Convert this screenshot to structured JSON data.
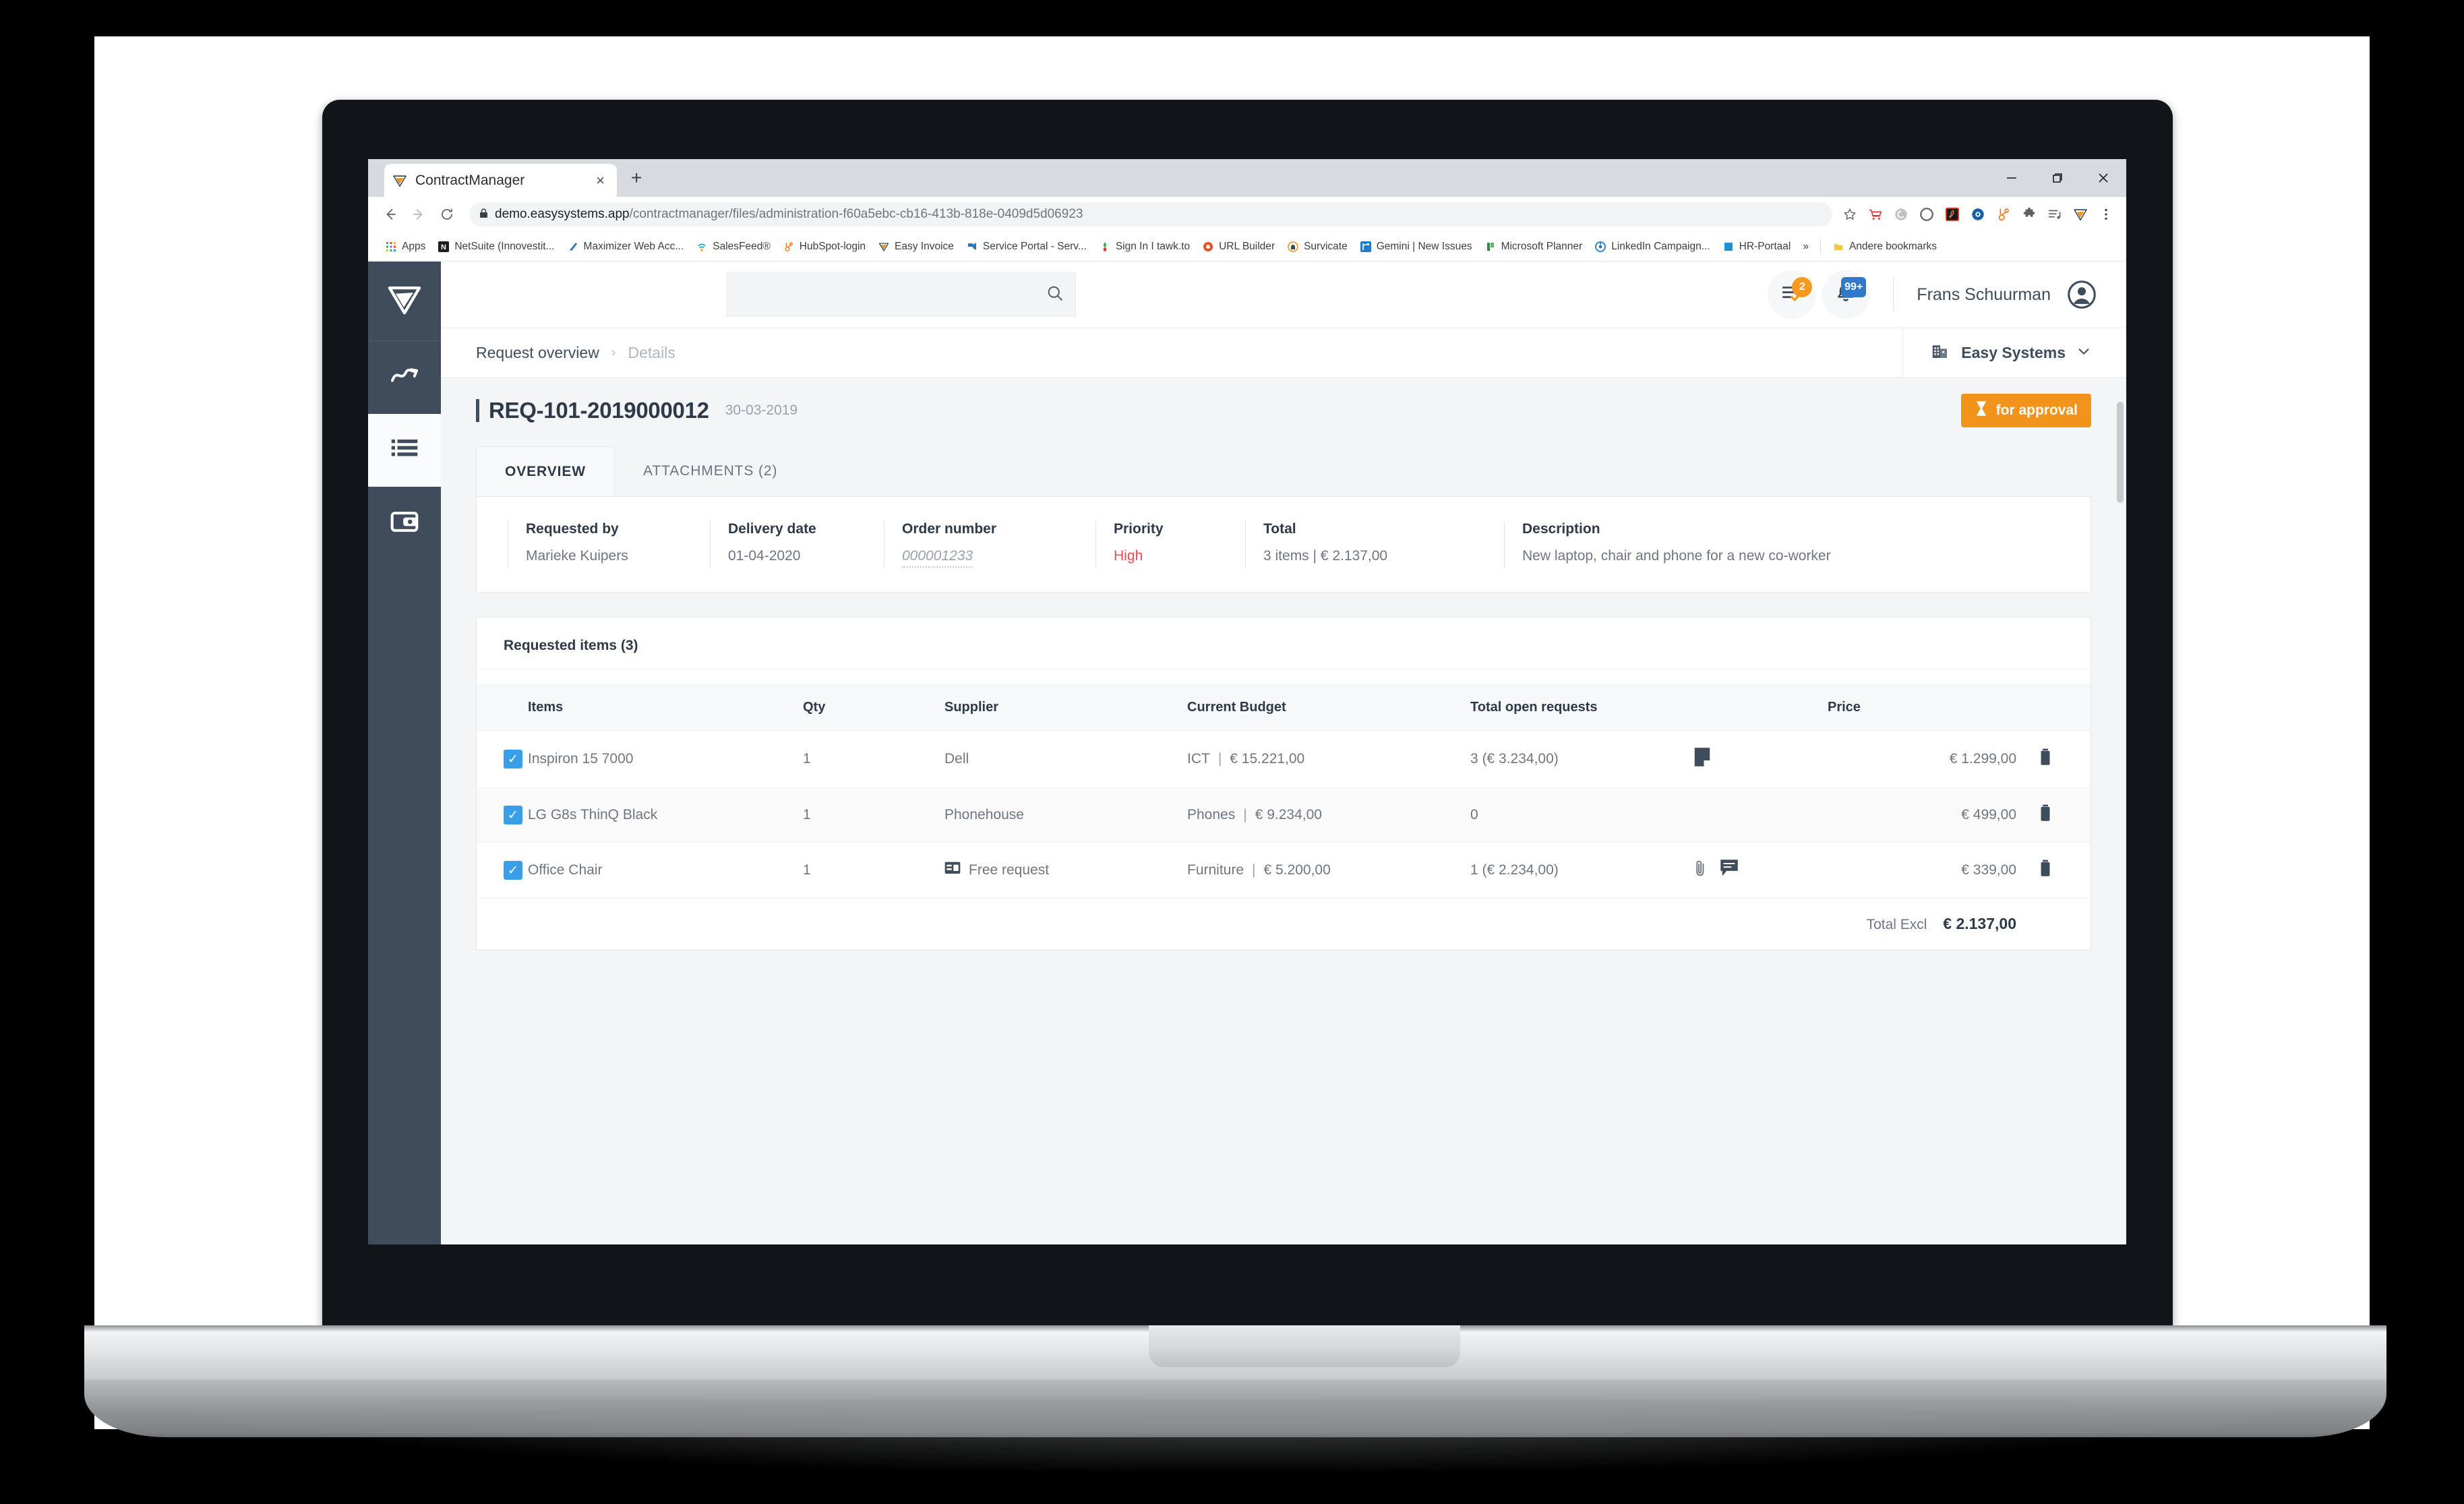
{
  "browser": {
    "tab": {
      "title": "ContractManager",
      "favicon": "easysystems-logo-icon",
      "close": "×"
    },
    "new_tab": "+",
    "window_controls": {
      "minimize": "—",
      "maximize": "❐",
      "close": "✕"
    },
    "nav": {
      "back": "←",
      "forward": "→",
      "reload": "⟳"
    },
    "omnibox": {
      "lock": "lock-icon",
      "url_domain": "demo.easysystems.app",
      "url_path": "/contractmanager/files/administration-f60a5ebc-cb16-413b-818e-0409d5d06923"
    },
    "extensions": [
      "star-icon",
      "shopping-cart-icon",
      "grammarly-icon",
      "opera-icon",
      "adobe-acrobat-icon",
      "messaging-icon",
      "hubspot-icon",
      "puzzle-extension-icon",
      "playlist-icon",
      "easysystems-icon",
      "chrome-menu-icon"
    ],
    "bookmarks": [
      {
        "label": "Apps",
        "icon": "apps-grid-icon"
      },
      {
        "label": "NetSuite (Innovestit...",
        "icon": "netsuite-icon"
      },
      {
        "label": "Maximizer Web Acc...",
        "icon": "maximizer-icon"
      },
      {
        "label": "SalesFeed®",
        "icon": "salesfeed-icon"
      },
      {
        "label": "HubSpot-login",
        "icon": "hubspot-icon"
      },
      {
        "label": "Easy Invoice",
        "icon": "easy-invoice-icon"
      },
      {
        "label": "Service Portal - Serv...",
        "icon": "service-portal-icon"
      },
      {
        "label": "Sign In I tawk.to",
        "icon": "tawkto-icon"
      },
      {
        "label": "URL Builder",
        "icon": "url-builder-icon"
      },
      {
        "label": "Survicate",
        "icon": "survicate-icon"
      },
      {
        "label": "Gemini | New Issues",
        "icon": "gemini-icon"
      },
      {
        "label": "Microsoft Planner",
        "icon": "microsoft-planner-icon"
      },
      {
        "label": "LinkedIn Campaign...",
        "icon": "linkedin-icon"
      },
      {
        "label": "HR-Portaal",
        "icon": "hr-portaal-icon"
      }
    ],
    "bookmarks_overflow": "»",
    "other_bookmarks": {
      "label": "Andere bookmarks",
      "icon": "folder-icon"
    }
  },
  "sidebar": {
    "logo": "easysystems-logo-icon",
    "items": [
      {
        "name": "analytics",
        "icon": "analytics-chart-icon",
        "active": false
      },
      {
        "name": "requests",
        "icon": "list-icon",
        "active": true
      },
      {
        "name": "invoices",
        "icon": "wallet-card-icon",
        "active": false
      }
    ]
  },
  "header": {
    "search": {
      "value": "",
      "placeholder": "",
      "icon": "search-icon"
    },
    "tasks": {
      "icon": "tasks-icon",
      "badge": "2",
      "badge_color": "#f59a1e"
    },
    "notifications": {
      "icon": "bell-icon",
      "badge": "99+",
      "badge_color": "#2f79c8"
    },
    "user": {
      "name": "Frans Schuurman",
      "avatar": "user-avatar-icon"
    }
  },
  "breadcrumb": {
    "parent": "Request overview",
    "separator": "›",
    "current": "Details"
  },
  "org_selector": {
    "icon": "building-icon",
    "name": "Easy Systems",
    "chevron": "⌄"
  },
  "title_bar": {
    "title": "REQ-101-2019000012",
    "date": "30-03-2019",
    "status": {
      "label": "for approval",
      "icon": "hourglass-icon",
      "color": "#f2941c"
    }
  },
  "tabs": [
    {
      "label": "OVERVIEW",
      "active": true
    },
    {
      "label": "ATTACHMENTS (2)",
      "active": false
    }
  ],
  "info_card": [
    {
      "label": "Requested by",
      "value": "Marieke Kuipers",
      "style": "normal"
    },
    {
      "label": "Delivery date",
      "value": "01-04-2020",
      "style": "normal"
    },
    {
      "label": "Order number",
      "value": "000001233",
      "style": "dotted"
    },
    {
      "label": "Priority",
      "value": "High",
      "style": "high"
    },
    {
      "label": "Total",
      "value": "3 items | € 2.137,00",
      "style": "normal"
    },
    {
      "label": "Description",
      "value": "New laptop, chair and phone for a new co-worker",
      "style": "normal"
    }
  ],
  "items_section": {
    "heading": "Requested items (3)",
    "columns": {
      "items": "Items",
      "qty": "Qty",
      "supplier": "Supplier",
      "budget": "Current Budget",
      "open_requests": "Total open requests",
      "icons": "",
      "price": "Price",
      "delete": ""
    },
    "rows": [
      {
        "checked": true,
        "item": "Inspiron 15 7000",
        "qty": "1",
        "supplier": "Dell",
        "supplier_icon": "",
        "budget_name": "ICT",
        "budget_amount": "€ 15.221,00",
        "open_requests": "3 (€ 3.234,00)",
        "icons": [
          "note-icon"
        ],
        "price": "€ 1.299,00",
        "delete_icon": "trash-icon",
        "alt": false
      },
      {
        "checked": true,
        "item": "LG G8s ThinQ Black",
        "qty": "1",
        "supplier": "Phonehouse",
        "supplier_icon": "",
        "budget_name": "Phones",
        "budget_amount": "€ 9.234,00",
        "open_requests": "0",
        "icons": [],
        "price": "€ 499,00",
        "delete_icon": "trash-icon",
        "alt": true
      },
      {
        "checked": true,
        "item": "Office Chair",
        "qty": "1",
        "supplier": "Free request",
        "supplier_icon": "free-request-icon",
        "budget_name": "Furniture",
        "budget_amount": "€ 5.200,00",
        "open_requests": "1 (€ 2.234,00)",
        "icons": [
          "attachment-icon",
          "comment-icon"
        ],
        "price": "€ 339,00",
        "delete_icon": "trash-icon",
        "alt": false
      }
    ],
    "total": {
      "label": "Total Excl",
      "value": "€ 2.137,00"
    }
  },
  "colors": {
    "sidebar": "#3f4c5c",
    "accent_orange": "#f2941c",
    "accent_blue": "#38a0e8",
    "priority_high": "#ea4b4b",
    "badge_blue": "#2f79c8",
    "text_dark": "#2f3a48",
    "text_muted": "#6e7681"
  }
}
